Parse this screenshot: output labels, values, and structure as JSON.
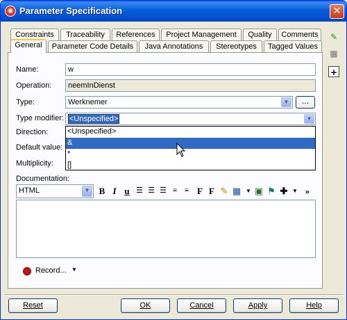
{
  "window": {
    "title": "Parameter Specification",
    "close_label": "✕"
  },
  "tabs_row1": [
    "Constraints",
    "Traceability",
    "References",
    "Project Management",
    "Quality",
    "Comments"
  ],
  "tabs_row2": [
    "General",
    "Parameter Code Details",
    "Java Annotations",
    "Stereotypes",
    "Tagged Values"
  ],
  "active_tab": "General",
  "form": {
    "name_label": "Name:",
    "name_value": "w",
    "operation_label": "Operation:",
    "operation_value": "neemInDienst",
    "type_label": "Type:",
    "type_value": "Werknemer",
    "type_browse": "...",
    "type_modifier_label": "Type modifier:",
    "type_modifier_value": "<Unspecified>",
    "direction_label": "Direction:",
    "default_value_label": "Default value:",
    "multiplicity_label": "Multiplicity:",
    "documentation_label": "Documentation:"
  },
  "type_modifier_options": [
    "<Unspecified>",
    "&",
    "*",
    "[]"
  ],
  "type_modifier_highlighted": "&",
  "doc_toolbar": {
    "format_value": "HTML",
    "bold": "B",
    "italic": "I",
    "underline": "u",
    "font": "F",
    "font_size": "F",
    "more": "»"
  },
  "record_label": "Record...",
  "buttons": {
    "reset": "Reset",
    "ok": "OK",
    "cancel": "Cancel",
    "apply": "Apply",
    "help": "Help"
  },
  "colors": {
    "title_bar": "#0a5ddb",
    "selection": "#316ac5",
    "tab_active_accent": "#ffc83c",
    "record_red": "#c0161b"
  }
}
